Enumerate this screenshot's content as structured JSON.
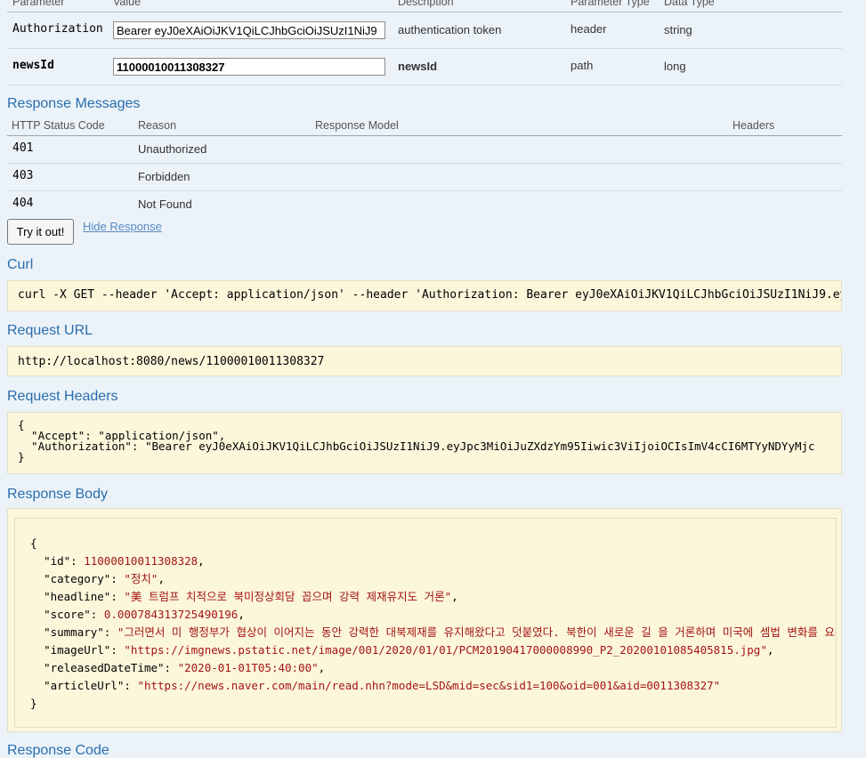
{
  "params": {
    "headers": [
      "Parameter",
      "Value",
      "Description",
      "Parameter Type",
      "Data Type"
    ],
    "rows": [
      {
        "name": "Authorization",
        "value": "Bearer eyJ0eXAiOiJKV1QiLCJhbGciOiJSUzI1NiJ9",
        "description": "authentication token",
        "param_type": "header",
        "data_type": "string"
      },
      {
        "name": "newsId",
        "value": "11000010011308327",
        "description": "newsId",
        "param_type": "path",
        "data_type": "long"
      }
    ]
  },
  "response_messages": {
    "title": "Response Messages",
    "headers": [
      "HTTP Status Code",
      "Reason",
      "Response Model",
      "Headers"
    ],
    "rows": [
      {
        "code": "401",
        "reason": "Unauthorized"
      },
      {
        "code": "403",
        "reason": "Forbidden"
      },
      {
        "code": "404",
        "reason": "Not Found"
      }
    ]
  },
  "actions": {
    "try_label": "Try it out!",
    "hide_label": "Hide Response"
  },
  "curl": {
    "title": "Curl",
    "text": "curl -X GET --header 'Accept: application/json' --header 'Authorization: Bearer eyJ0eXAiOiJKV1QiLCJhbGciOiJSUzI1NiJ9.ey"
  },
  "request_url": {
    "title": "Request URL",
    "text": "http://localhost:8080/news/11000010011308327"
  },
  "request_headers": {
    "title": "Request Headers",
    "text": "{\n  \"Accept\": \"application/json\",\n  \"Authorization\": \"Bearer eyJ0eXAiOiJKV1QiLCJhbGciOiJSUzI1NiJ9.eyJpc3MiOiJuZXdzYm95Iiwic3ViIjoiOCIsImV4cCI6MTYyNDYyMjc\n}"
  },
  "response_body": {
    "title": "Response Body",
    "id": "11000010011308328",
    "category": "\"정치\"",
    "headline": "\"美 트럼프 치적으로 북미정상회담 꼽으며 강력 제재유지도 거론\"",
    "score": "0.000784313725490196",
    "summary": "\"그러면서 미 행정부가 협상이 이어지는 동안 강력한 대북제재를 유지해왔다고 덧붙였다. 북한이 새로운 길 을 거론하며 미국에 셈법 변화를 요구",
    "imageUrl": "\"https://imgnews.pstatic.net/image/001/2020/01/01/PCM20190417000008990_P2_20200101085405815.jpg\"",
    "releasedDateTime": "\"2020-01-01T05:40:00\"",
    "articleUrl": "\"https://news.naver.com/main/read.nhn?mode=LSD&mid=sec&sid1=100&oid=001&aid=0011308327\""
  },
  "response_code": {
    "title": "Response Code"
  }
}
